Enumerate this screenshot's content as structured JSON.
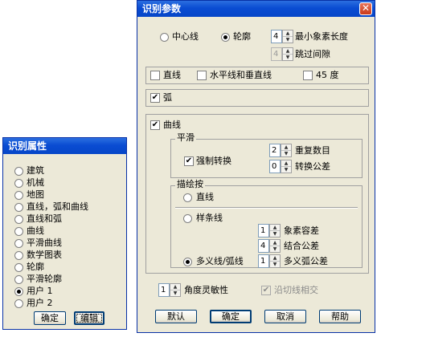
{
  "small_dialog": {
    "title": "识别属性",
    "options": [
      {
        "label": "建筑",
        "selected": false
      },
      {
        "label": "机械",
        "selected": false
      },
      {
        "label": "地图",
        "selected": false
      },
      {
        "label": "直线，弧和曲线",
        "selected": false
      },
      {
        "label": "直线和弧",
        "selected": false
      },
      {
        "label": "曲线",
        "selected": false
      },
      {
        "label": "平滑曲线",
        "selected": false
      },
      {
        "label": "数学图表",
        "selected": false
      },
      {
        "label": "轮廓",
        "selected": false
      },
      {
        "label": "平滑轮廓",
        "selected": false
      },
      {
        "label": "用户 1",
        "selected": true
      },
      {
        "label": "用户 2",
        "selected": false
      }
    ],
    "ok_label": "确定",
    "edit_label": "编辑"
  },
  "main_dialog": {
    "title": "识别参数",
    "close_glyph": "✕",
    "centerline_label": "中心线",
    "outline_label": "轮廓",
    "min_pixel_length": {
      "value": "4",
      "label": "最小象素长度"
    },
    "skip_gap": {
      "value": "4",
      "label": "跳过间隙"
    },
    "line_label": "直线",
    "hv_line_label": "水平线和垂直线",
    "deg45_label": "45 度",
    "arc_label": "弧",
    "curve_label": "曲线",
    "smooth_group": "平滑",
    "repeat_count": {
      "value": "2",
      "label": "重复数目"
    },
    "force_convert_label": "强制转换",
    "convert_tolerance": {
      "value": "0",
      "label": "转换公差"
    },
    "trace_group": "描绘按",
    "trace_line_label": "直线",
    "spline_label": "样条线",
    "pixel_tolerance": {
      "value": "1",
      "label": "象素容差"
    },
    "fit_tolerance": {
      "value": "4",
      "label": "结合公差"
    },
    "polyline_arc_label": "多义线/弧线",
    "polyarc_tolerance": {
      "value": "1",
      "label": "多义弧公差"
    },
    "angle_sensitivity": {
      "value": "1",
      "label": "角度灵敏性"
    },
    "tangent_label": "沿切线相交",
    "buttons": {
      "default": "默认",
      "ok": "确定",
      "cancel": "取消",
      "help": "帮助"
    }
  }
}
